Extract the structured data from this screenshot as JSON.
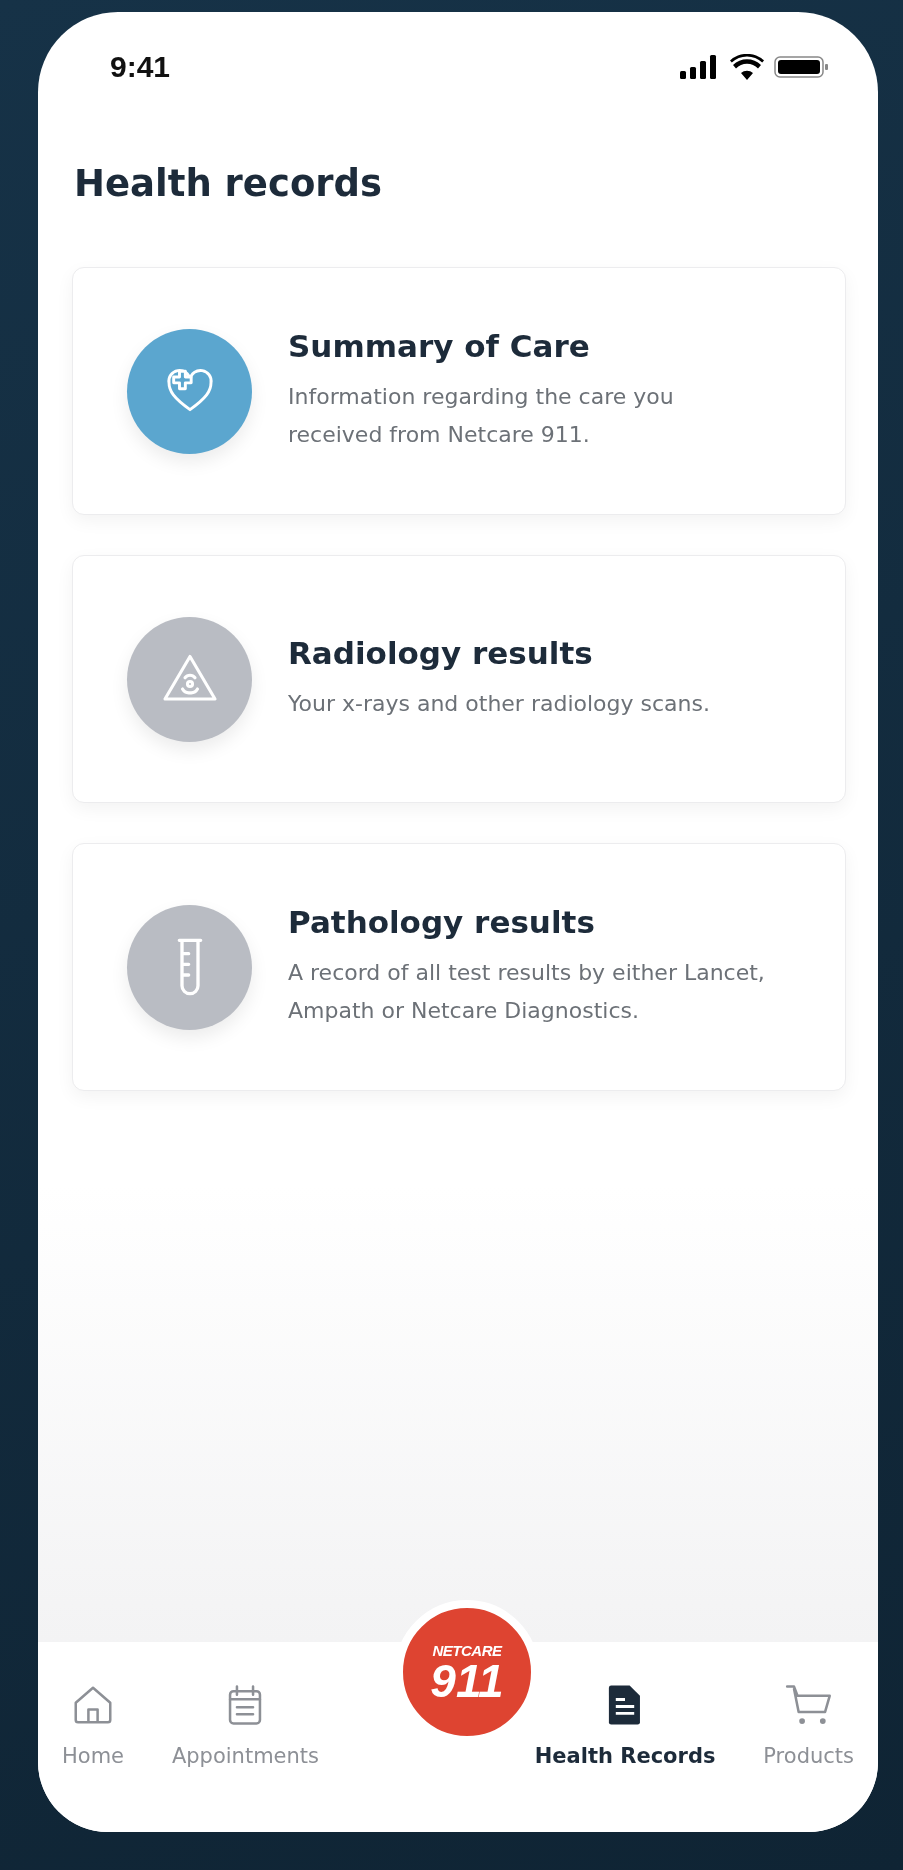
{
  "status_bar": {
    "time": "9:41"
  },
  "title": "Health records",
  "cards": [
    {
      "title": "Summary of Care",
      "description": "Information regarding the care you received from Netcare 911.",
      "kind": "heart",
      "color": "#5ba6cf"
    },
    {
      "title": "Radiology results",
      "description": "Your x-rays and other radiology scans.",
      "kind": "radiation",
      "color": "#b9bcc3"
    },
    {
      "title": "Pathology results",
      "description": "A record of all test results by either Lancet, Ampath or Netcare Diagnostics.",
      "kind": "tube",
      "color": "#b9bcc3"
    }
  ],
  "center_button": {
    "brand": "NETCARE",
    "number": "911"
  },
  "nav": [
    {
      "label": "Home",
      "kind": "home",
      "selected": false
    },
    {
      "label": "Appointments",
      "kind": "calendar",
      "selected": false
    },
    {
      "kind": "spacer"
    },
    {
      "label": "Health Records",
      "kind": "document",
      "selected": true
    },
    {
      "label": "Products",
      "kind": "cart",
      "selected": false
    }
  ]
}
